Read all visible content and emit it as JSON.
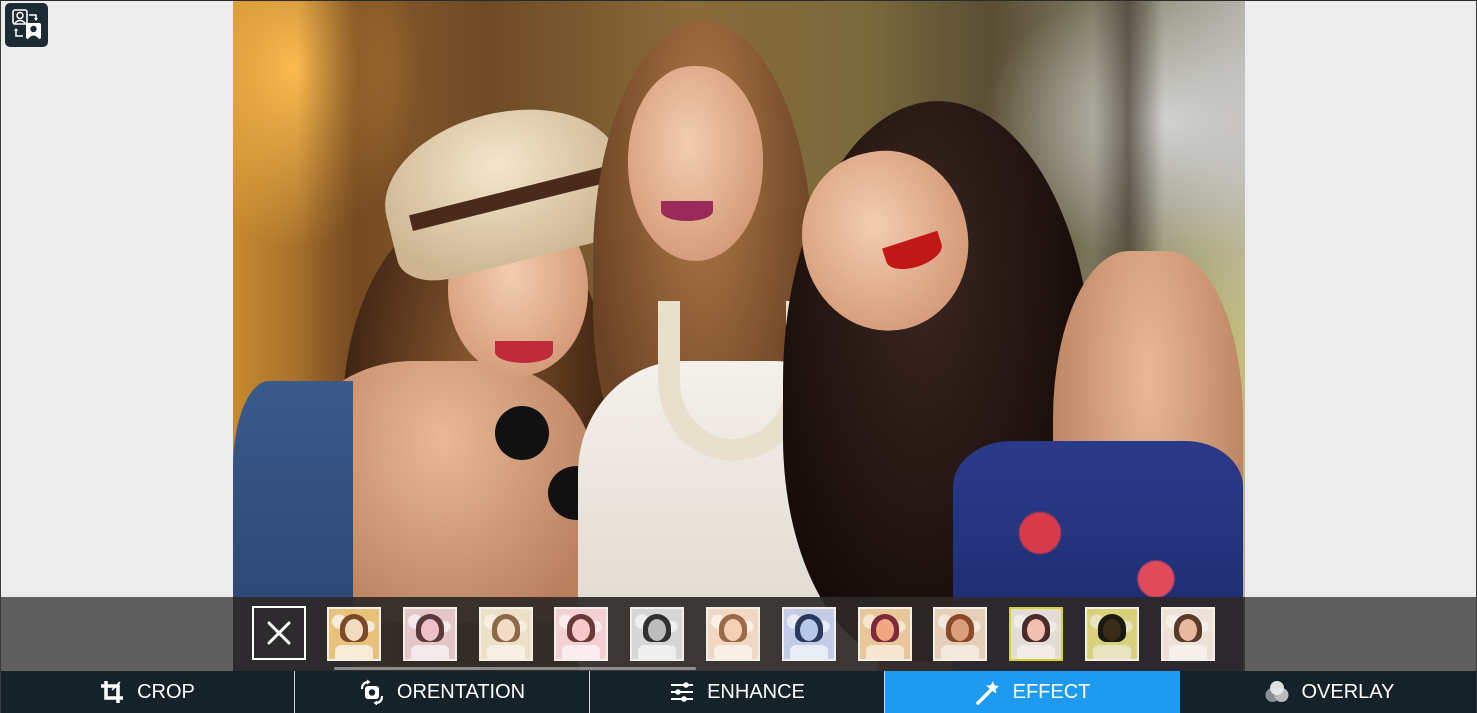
{
  "app": {
    "icon": "swap-faces-icon"
  },
  "photo": {
    "description": "Three smiling young women posing outdoors"
  },
  "effects_strip": {
    "cancel_icon": "close-icon",
    "selected_index": 9,
    "thumbnails": [
      {
        "name": "effect-1",
        "tone": [
          "#e8c27a",
          "#7a4a2a",
          "#f2dcc0",
          "#f7ecd8"
        ]
      },
      {
        "name": "effect-2",
        "tone": [
          "#e4c6c8",
          "#5a3a3a",
          "#f0c0c8",
          "#f4e8ea"
        ]
      },
      {
        "name": "effect-3",
        "tone": [
          "#ece0c6",
          "#8a6a4a",
          "#f4dcc4",
          "#f6efe2"
        ]
      },
      {
        "name": "effect-4",
        "tone": [
          "#f4d0d4",
          "#6a3a3a",
          "#f8c8cc",
          "#fbecee"
        ]
      },
      {
        "name": "effect-5",
        "tone": [
          "#d6d6d6",
          "#303030",
          "#bcbcbc",
          "#efefef"
        ]
      },
      {
        "name": "effect-6",
        "tone": [
          "#f2d8c2",
          "#9a6a4a",
          "#f6d0b4",
          "#f9efe4"
        ]
      },
      {
        "name": "effect-7",
        "tone": [
          "#c4cce8",
          "#2a3a5a",
          "#b8c8e8",
          "#e8ecf6"
        ]
      },
      {
        "name": "effect-8",
        "tone": [
          "#e8c89a",
          "#7a2a3a",
          "#f0a880",
          "#f6e6d0"
        ]
      },
      {
        "name": "effect-9",
        "tone": [
          "#e6cfb8",
          "#8a4a2a",
          "#d8a07a",
          "#f3e8dc"
        ]
      },
      {
        "name": "effect-10",
        "tone": [
          "#e4dcd6",
          "#4a2a2a",
          "#f0c0b0",
          "#f2ece8"
        ]
      },
      {
        "name": "effect-11",
        "tone": [
          "#d8d07a",
          "#1a1a10",
          "#3a2a18",
          "#e8e4c0"
        ]
      },
      {
        "name": "effect-12",
        "tone": [
          "#eee2d8",
          "#5a3a2a",
          "#e8b8a0",
          "#f6f0ea"
        ]
      }
    ]
  },
  "tabs": [
    {
      "label": "CROP",
      "icon": "crop-icon",
      "active": false
    },
    {
      "label": "ORENTATION",
      "icon": "rotate-icon",
      "active": false
    },
    {
      "label": "ENHANCE",
      "icon": "sliders-icon",
      "active": false
    },
    {
      "label": "EFFECT",
      "icon": "magic-wand-icon",
      "active": true
    },
    {
      "label": "OVERLAY",
      "icon": "overlay-circles-icon",
      "active": false
    }
  ],
  "colors": {
    "active_tab": "#1e9bf0",
    "tabbar": "#15222a",
    "selected_thumb_border": "#d8d32a",
    "background": "#ececec"
  }
}
